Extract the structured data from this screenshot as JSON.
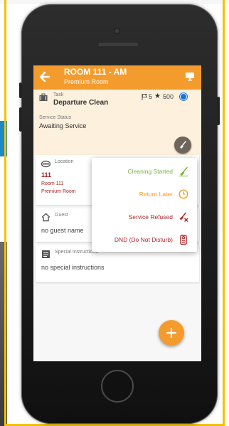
{
  "header": {
    "title": "ROOM 111 - AM",
    "subtitle": "Premium Room"
  },
  "task": {
    "label": "Task",
    "value": "Departure Clean",
    "flag_count": "5",
    "star_glyph": "★",
    "points": "500",
    "status_label": "Service Status",
    "status_value": "Awaiting Service"
  },
  "location": {
    "label": "Location",
    "number": "111",
    "room": "Room 111",
    "room_type": "Premium Room"
  },
  "guest": {
    "label": "Guest",
    "value": "no guest name"
  },
  "instructions": {
    "label": "Special Instructions",
    "value": "no special instructions"
  },
  "menu": {
    "items": [
      {
        "label": "Cleaning Started",
        "color": "#7cb342",
        "icon": "broom-icon"
      },
      {
        "label": "Return Later",
        "color": "#f39c2d",
        "icon": "clock-icon"
      },
      {
        "label": "Service Refused",
        "color": "#b0262c",
        "icon": "broom-refused-icon"
      },
      {
        "label": "DND (Do Not Disturb)",
        "color": "#b0262c",
        "icon": "door-hanger-icon"
      }
    ]
  },
  "colors": {
    "accent": "#f39c2d",
    "task_card_bg": "#fdf0dc",
    "location_text": "#a42222"
  }
}
